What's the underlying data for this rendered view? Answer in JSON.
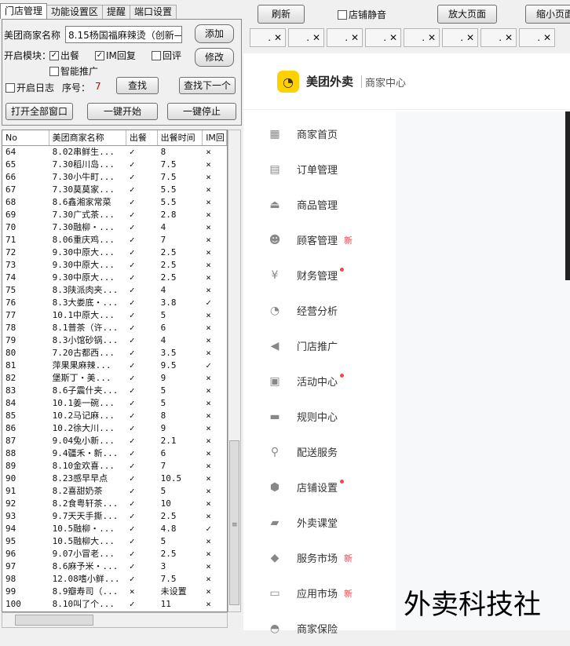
{
  "tabs": [
    "门店管理",
    "功能设置区",
    "提醒",
    "端口设置"
  ],
  "form": {
    "store_label": "美团商家名称",
    "store_value": "8.15杨国福麻辣烫（创新—",
    "add": "添加",
    "module_label": "开启模块：",
    "chk_out": "出餐",
    "chk_im": "IM回复",
    "chk_review": "回评",
    "modify": "修改",
    "chk_promo": "智能推广",
    "chk_log": "开启日志",
    "seq_label": "序号：",
    "seq_value": "7",
    "find": "查找",
    "find_next": "查找下一个",
    "open_all": "打开全部窗口",
    "start_all": "一键开始",
    "stop_all": "一键停止"
  },
  "grid": {
    "headers": [
      "No",
      "美团商家名称",
      "出餐",
      "出餐时间",
      "IM回"
    ],
    "rows": [
      [
        "64",
        "8.02串鲜生...",
        "✓",
        "8",
        "×"
      ],
      [
        "65",
        "7.30稻川岛...",
        "✓",
        "7.5",
        "×"
      ],
      [
        "66",
        "7.30小牛町...",
        "✓",
        "7.5",
        "×"
      ],
      [
        "67",
        "7.30莫莫家...",
        "✓",
        "5.5",
        "×"
      ],
      [
        "68",
        "8.6鑫湘家常菜",
        "✓",
        "5.5",
        "×"
      ],
      [
        "69",
        "7.30广式茶...",
        "✓",
        "2.8",
        "×"
      ],
      [
        "70",
        "7.30融柳・...",
        "✓",
        "4",
        "×"
      ],
      [
        "71",
        "8.06重庆鸡...",
        "✓",
        "7",
        "×"
      ],
      [
        "72",
        "9.30中原大...",
        "✓",
        "2.5",
        "×"
      ],
      [
        "73",
        "9.30中原大...",
        "✓",
        "2.5",
        "×"
      ],
      [
        "74",
        "9.30中原大...",
        "✓",
        "2.5",
        "×"
      ],
      [
        "75",
        "8.3陕派肉夹...",
        "✓",
        "4",
        "×"
      ],
      [
        "76",
        "8.3大娄底・...",
        "✓",
        "3.8",
        "✓"
      ],
      [
        "77",
        "10.1中原大...",
        "✓",
        "5",
        "×"
      ],
      [
        "78",
        "8.1普茶（许...",
        "✓",
        "6",
        "×"
      ],
      [
        "79",
        "8.3小馆砂锅...",
        "✓",
        "4",
        "×"
      ],
      [
        "80",
        "7.20古都西...",
        "✓",
        "3.5",
        "×"
      ],
      [
        "81",
        "萍果果麻辣...",
        "✓",
        "9.5",
        "✓"
      ],
      [
        "82",
        "堡斯丁・美...",
        "✓",
        "9",
        "×"
      ],
      [
        "83",
        "8.6子震什夹...",
        "✓",
        "5",
        "×"
      ],
      [
        "84",
        "10.1姜一碗...",
        "✓",
        "5",
        "×"
      ],
      [
        "85",
        "10.2马记麻...",
        "✓",
        "8",
        "×"
      ],
      [
        "86",
        "10.2徐大川...",
        "✓",
        "9",
        "×"
      ],
      [
        "87",
        "9.04兔小新...",
        "✓",
        "2.1",
        "×"
      ],
      [
        "88",
        "9.4疆禾・新...",
        "✓",
        "6",
        "×"
      ],
      [
        "89",
        "8.10金欢喜...",
        "✓",
        "7",
        "×"
      ],
      [
        "90",
        "8.23感早早点",
        "✓",
        "10.5",
        "×"
      ],
      [
        "91",
        "8.2喜甜奶茶",
        "✓",
        "5",
        "×"
      ],
      [
        "92",
        "8.2食粤轩茶...",
        "✓",
        "10",
        "×"
      ],
      [
        "93",
        "9.7天天手撕...",
        "✓",
        "2.5",
        "×"
      ],
      [
        "94",
        "10.5融柳・...",
        "✓",
        "4.8",
        "✓"
      ],
      [
        "95",
        "10.5融柳大...",
        "✓",
        "5",
        "×"
      ],
      [
        "96",
        "9.07小冒老...",
        "✓",
        "2.5",
        "×"
      ],
      [
        "97",
        "8.6麻予米・...",
        "✓",
        "3",
        "×"
      ],
      [
        "98",
        "12.08嗜小鲜...",
        "✓",
        "7.5",
        "×"
      ],
      [
        "99",
        "8.9瓣寿司（...",
        "×",
        "未设置",
        "×"
      ],
      [
        "100",
        "8.10叫了个...",
        "✓",
        "11",
        "×"
      ]
    ]
  },
  "toolbar": {
    "refresh": "刷新",
    "mute": "店铺静音",
    "zoom_in": "放大页面",
    "zoom_out": "缩小页面"
  },
  "browser_tabs": [
    ".",
    ".",
    ".",
    ".",
    ".",
    ".",
    ".",
    "."
  ],
  "header": {
    "brand": "美团外卖",
    "sub": "商家中心"
  },
  "menu": [
    {
      "label": "商家首页",
      "icon": "▦",
      "badge": ""
    },
    {
      "label": "订单管理",
      "icon": "▤",
      "badge": ""
    },
    {
      "label": "商品管理",
      "icon": "⏏",
      "badge": ""
    },
    {
      "label": "顾客管理",
      "icon": "☻",
      "badge": "新"
    },
    {
      "label": "财务管理",
      "icon": "¥",
      "badge": "dot"
    },
    {
      "label": "经营分析",
      "icon": "◔",
      "badge": ""
    },
    {
      "label": "门店推广",
      "icon": "◀",
      "badge": ""
    },
    {
      "label": "活动中心",
      "icon": "▣",
      "badge": "dot"
    },
    {
      "label": "规则中心",
      "icon": "▬",
      "badge": ""
    },
    {
      "label": "配送服务",
      "icon": "⚲",
      "badge": ""
    },
    {
      "label": "店铺设置",
      "icon": "⬢",
      "badge": "dot"
    },
    {
      "label": "外卖课堂",
      "icon": "▰",
      "badge": ""
    },
    {
      "label": "服务市场",
      "icon": "◆",
      "badge": "新"
    },
    {
      "label": "应用市场",
      "icon": "▭",
      "badge": "新"
    },
    {
      "label": "商家保险",
      "icon": "◓",
      "badge": ""
    }
  ],
  "watermark": "外卖科技社"
}
